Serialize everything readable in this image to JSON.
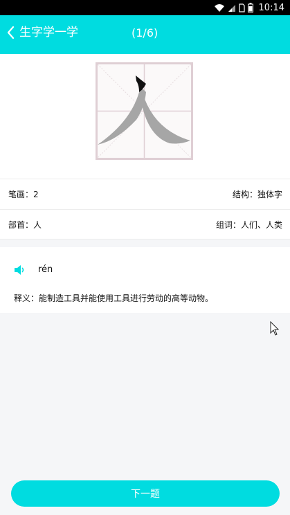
{
  "status_bar": {
    "time": "10:14",
    "icons": [
      "wifi-icon",
      "signal-icon",
      "sim-icon",
      "battery-icon"
    ]
  },
  "header": {
    "back_label": "生字学一学",
    "progress": "(1/6)",
    "background": "#00dce0"
  },
  "character": {
    "grid_border": "#dfcfd4"
  },
  "info": {
    "strokes": "笔画：2",
    "structure": "结构：独体字",
    "radical": "部首：人",
    "words": "组词：人们、人类"
  },
  "pronunciation": {
    "pinyin": "rén",
    "definition": "释义：能制造工具并能使用工具进行劳动的高等动物。"
  },
  "footer": {
    "next_label": "下一题"
  }
}
